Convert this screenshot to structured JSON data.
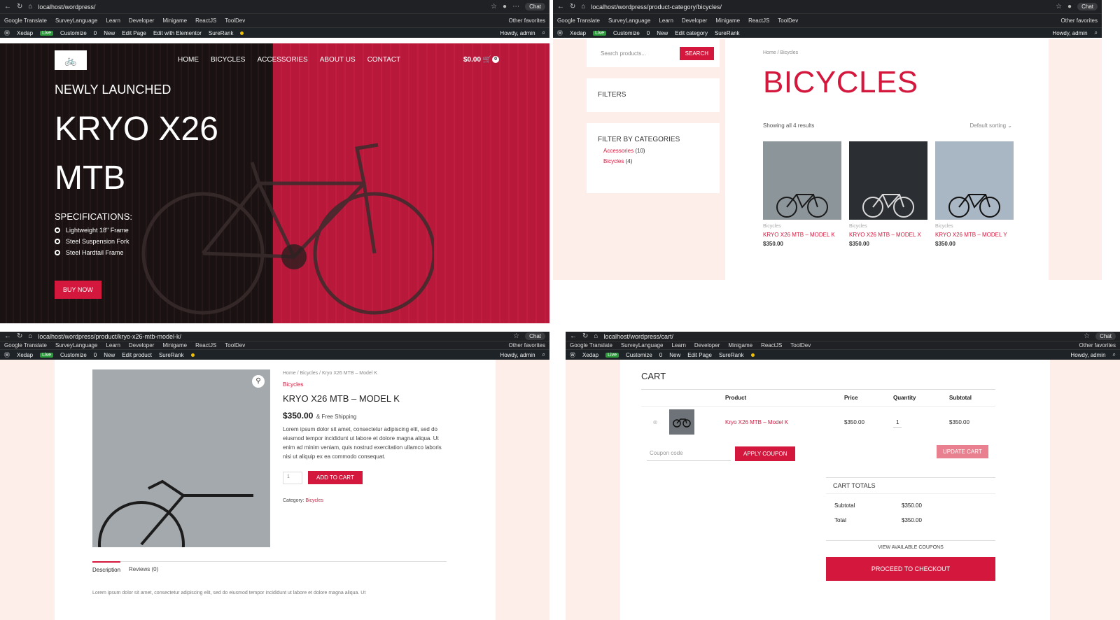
{
  "common": {
    "bookmarks": [
      "Google Translate",
      "SurveyLanguage",
      "Learn",
      "Developer",
      "Minigame",
      "ReactJS",
      "ToolDev"
    ],
    "other_favorites": "Other favorites",
    "admin": {
      "site": "Xedap",
      "live": "Live",
      "customize": "Customize",
      "comments": "0",
      "new": "New",
      "howdy": "Howdy, admin"
    },
    "chat": "Chat"
  },
  "w1": {
    "url": "localhost/wordpress/",
    "edit_page": "Edit Page",
    "edit_elementor": "Edit with Elementor",
    "surerank": "SureRank",
    "nav": [
      "HOME",
      "BICYCLES",
      "ACCESSORIES",
      "ABOUT US",
      "CONTACT"
    ],
    "cart_total": "$0.00",
    "cart_count": "0",
    "kicker": "NEWLY LAUNCHED",
    "headline_1": "KRYO X26",
    "headline_2": "MTB",
    "spec_title": "SPECIFICATIONS:",
    "specs": [
      "Lightweight 18\" Frame",
      "Steel Suspension Fork",
      "Steel Hardtail Frame"
    ],
    "buy_now": "BUY NOW",
    "colors": {
      "accent": "#d4183d",
      "dark": "#1a1212",
      "red_panel": "#b8183a"
    }
  },
  "w2": {
    "url": "localhost/wordpress/product-category/bicycles/",
    "edit_category": "Edit category",
    "search_placeholder": "Search products...",
    "search_btn": "SEARCH",
    "filters": "FILTERS",
    "filter_by": "FILTER BY CATEGORIES",
    "categories": [
      {
        "name": "Accessories",
        "count": "(10)"
      },
      {
        "name": "Bicycles",
        "count": "(4)"
      }
    ],
    "crumb": "Home / Bicycles",
    "title": "BICYCLES",
    "results": "Showing all 4 results",
    "sorting": "Default sorting",
    "products": [
      {
        "cat": "Bicycles",
        "name": "KRYO X26 MTB – MODEL K",
        "price": "$350.00"
      },
      {
        "cat": "Bicycles",
        "name": "KRYO X26 MTB – MODEL X",
        "price": "$350.00"
      },
      {
        "cat": "Bicycles",
        "name": "KRYO X26 MTB – MODEL Y",
        "price": "$350.00"
      }
    ]
  },
  "w3": {
    "url": "localhost/wordpress/product/kryo-x26-mtb-model-k/",
    "edit_product": "Edit product",
    "crumb": "Home / Bicycles / Kryo X26 MTB – Model K",
    "category": "Bicycles",
    "title": "KRYO X26 MTB – MODEL K",
    "price": "$350.00",
    "shipping": "& Free Shipping",
    "desc": "Lorem ipsum dolor sit amet, consectetur adipiscing elit, sed do eiusmod tempor incididunt ut labore et dolore magna aliqua. Ut enim ad minim veniam, quis nostrud exercitation ullamco laboris nisi ut aliquip ex ea commodo consequat.",
    "qty": "1",
    "add_to_cart": "ADD TO CART",
    "category_label": "Category:",
    "tabs": [
      "Description",
      "Reviews (0)"
    ],
    "desc_cut": "Lorem ipsum dolor sit amet, consectetur adipiscing elit, sed do eiusmod tempor incididunt ut labore et dolore magna aliqua. Ut"
  },
  "w4": {
    "url": "localhost/wordpress/cart/",
    "edit_page": "Edit Page",
    "surerank": "SureRank",
    "title": "CART",
    "headers": {
      "product": "Product",
      "price": "Price",
      "quantity": "Quantity",
      "subtotal": "Subtotal"
    },
    "item": {
      "name": "Kryo X26 MTB – Model K",
      "price": "$350.00",
      "qty": "1",
      "subtotal": "$350.00"
    },
    "coupon_placeholder": "Coupon code",
    "apply": "APPLY COUPON",
    "update": "UPDATE CART",
    "totals_title": "CART TOTALS",
    "subtotal_label": "Subtotal",
    "subtotal": "$350.00",
    "total_label": "Total",
    "total": "$350.00",
    "view_coupons": "VIEW AVAILABLE COUPONS",
    "checkout": "PROCEED TO CHECKOUT"
  }
}
